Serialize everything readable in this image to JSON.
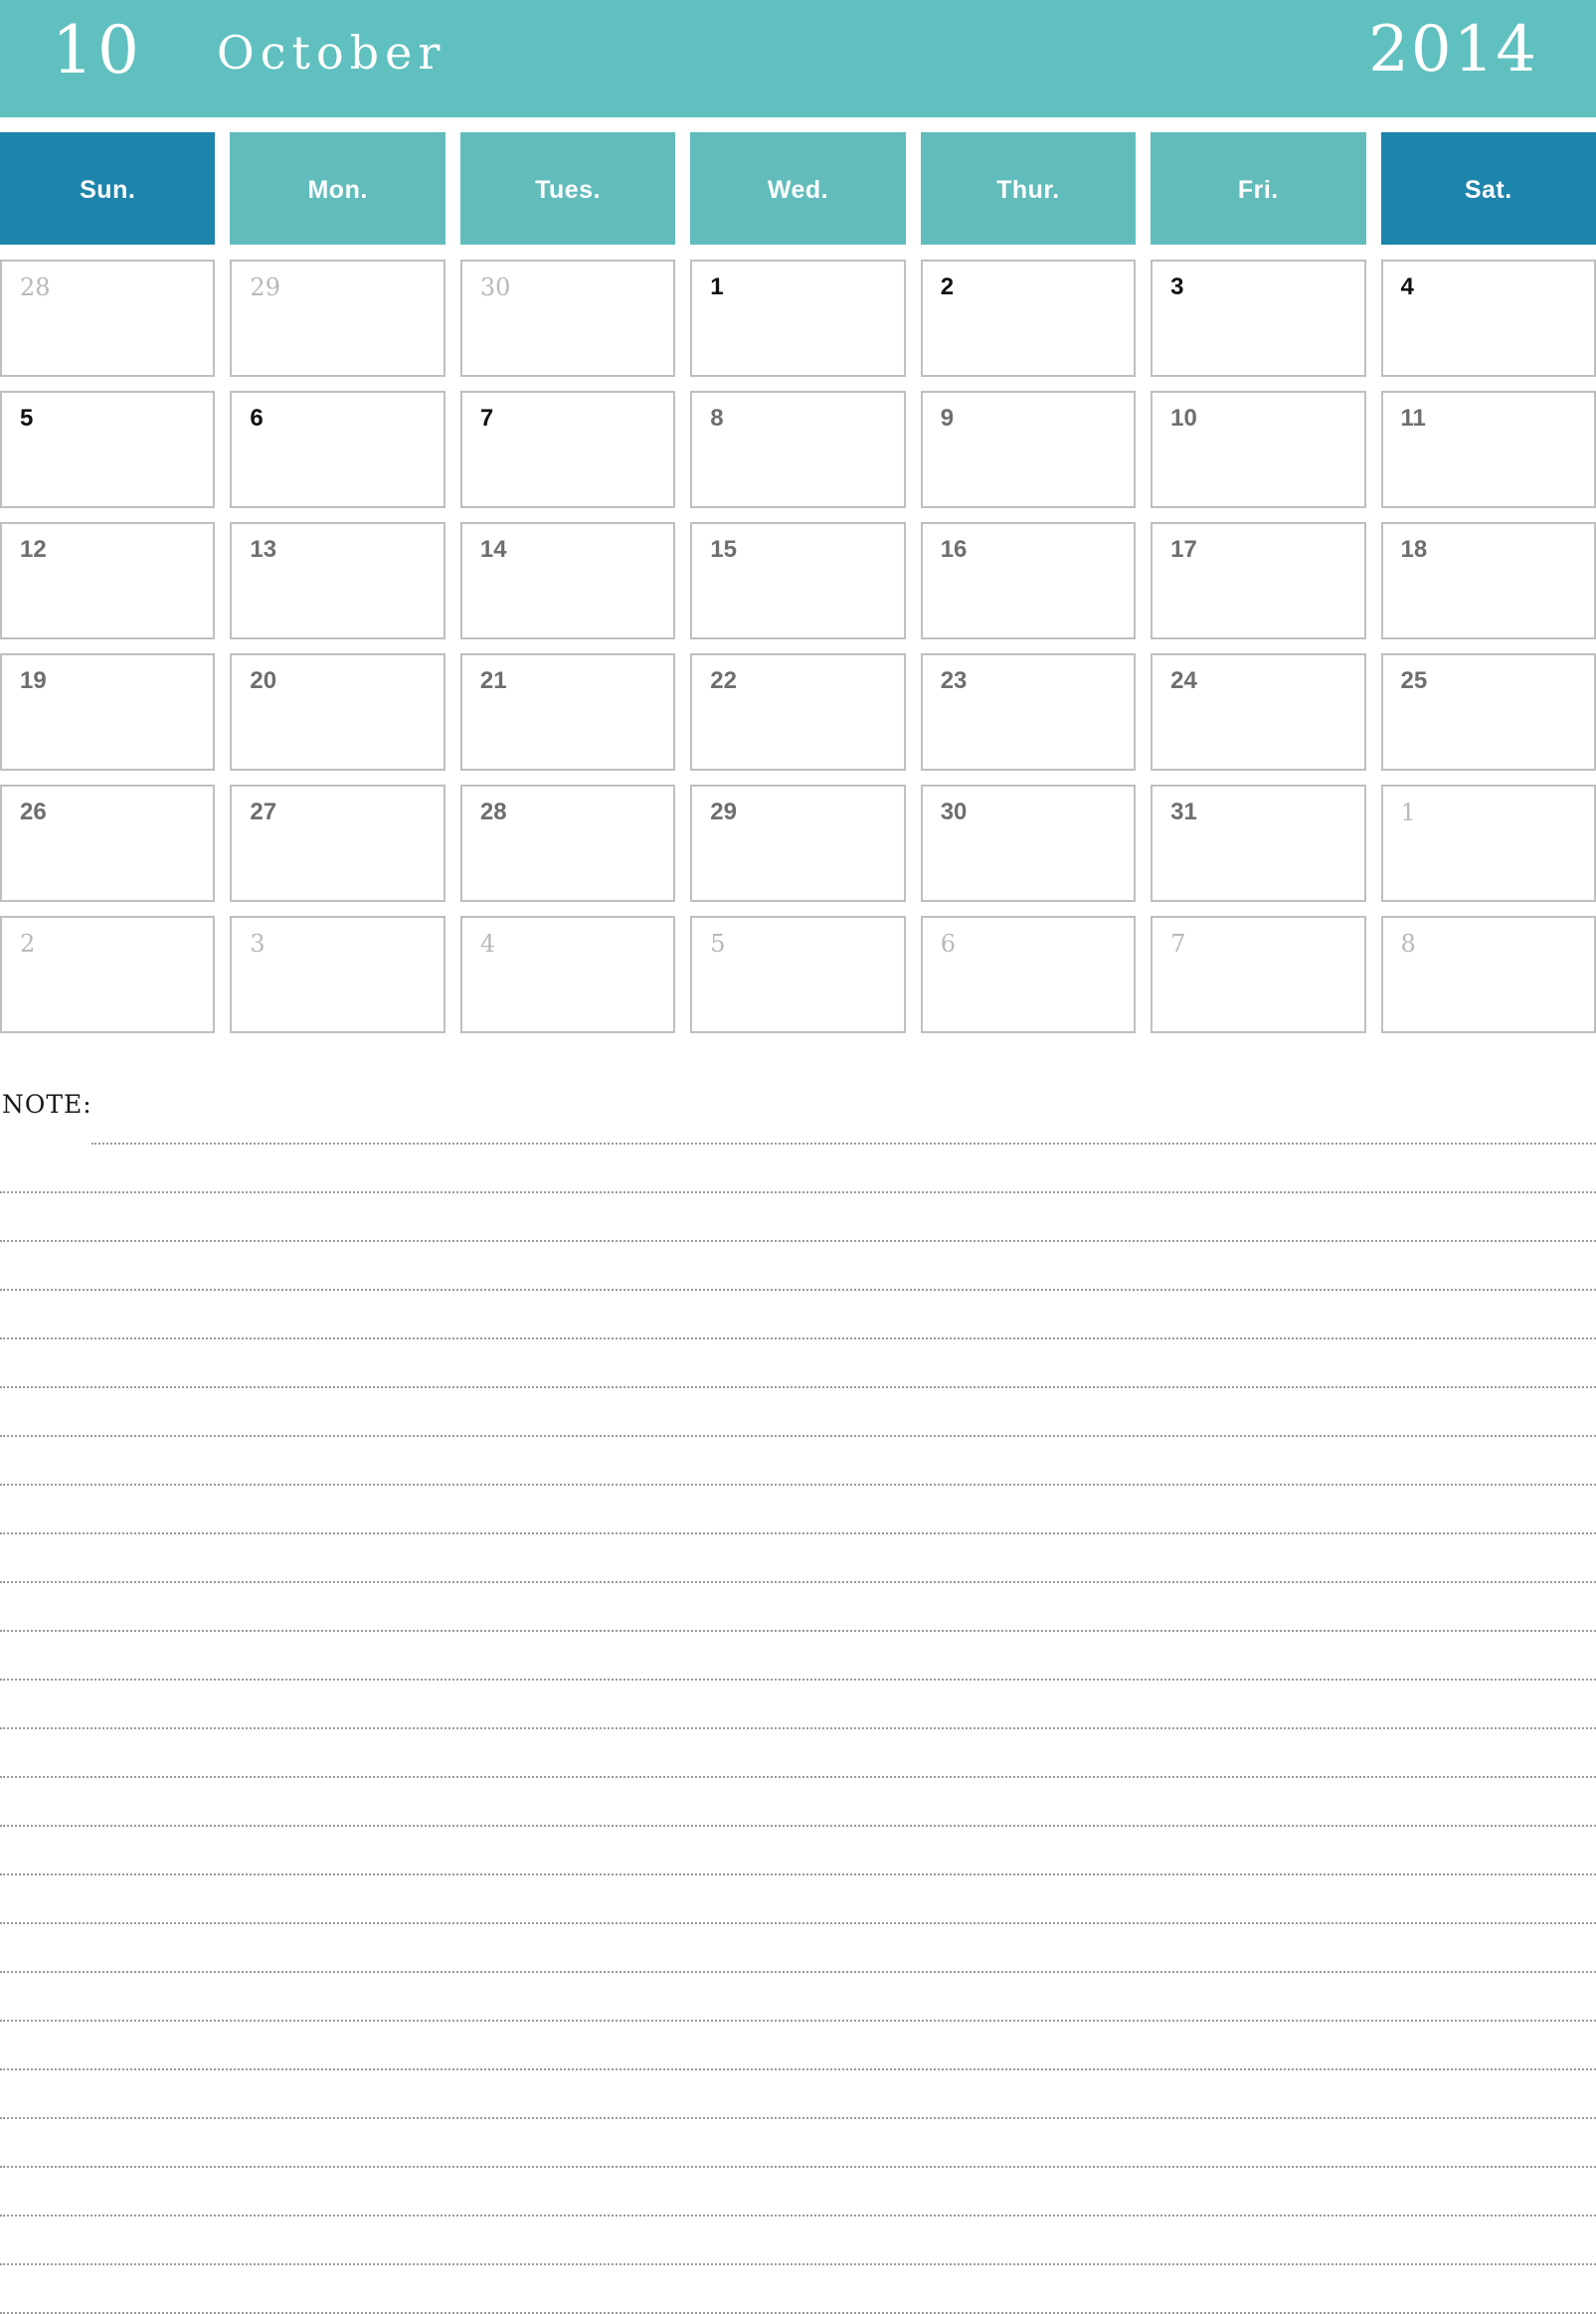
{
  "header": {
    "month_number": "10",
    "month_name": "October",
    "year": "2014",
    "banner_color": "#5fc0bf"
  },
  "weekdays": {
    "colors": {
      "weekday": "#62bcbc",
      "weekend": "#1d84ab",
      "text": "#ffffff"
    },
    "items": [
      {
        "label": "Sun.",
        "weekend": true
      },
      {
        "label": "Mon.",
        "weekend": false
      },
      {
        "label": "Tues.",
        "weekend": false
      },
      {
        "label": "Wed.",
        "weekend": false
      },
      {
        "label": "Thur.",
        "weekend": false
      },
      {
        "label": "Fri.",
        "weekend": false
      },
      {
        "label": "Sat.",
        "weekend": true
      }
    ]
  },
  "grid": {
    "colors": {
      "cell_border": "#bfbfbf",
      "date_strong": "#111111",
      "date_current": "#6e6e6e",
      "date_other": "#b9b9b9"
    },
    "rows": [
      [
        {
          "day": "28",
          "style": "other"
        },
        {
          "day": "29",
          "style": "other"
        },
        {
          "day": "30",
          "style": "other"
        },
        {
          "day": "1",
          "style": "cur-strong"
        },
        {
          "day": "2",
          "style": "cur-strong"
        },
        {
          "day": "3",
          "style": "cur-strong"
        },
        {
          "day": "4",
          "style": "cur-strong"
        }
      ],
      [
        {
          "day": "5",
          "style": "cur-strong"
        },
        {
          "day": "6",
          "style": "cur-strong"
        },
        {
          "day": "7",
          "style": "cur-strong"
        },
        {
          "day": "8",
          "style": "cur"
        },
        {
          "day": "9",
          "style": "cur"
        },
        {
          "day": "10",
          "style": "cur"
        },
        {
          "day": "11",
          "style": "cur"
        }
      ],
      [
        {
          "day": "12",
          "style": "cur"
        },
        {
          "day": "13",
          "style": "cur"
        },
        {
          "day": "14",
          "style": "cur"
        },
        {
          "day": "15",
          "style": "cur"
        },
        {
          "day": "16",
          "style": "cur"
        },
        {
          "day": "17",
          "style": "cur"
        },
        {
          "day": "18",
          "style": "cur"
        }
      ],
      [
        {
          "day": "19",
          "style": "cur"
        },
        {
          "day": "20",
          "style": "cur"
        },
        {
          "day": "21",
          "style": "cur"
        },
        {
          "day": "22",
          "style": "cur"
        },
        {
          "day": "23",
          "style": "cur"
        },
        {
          "day": "24",
          "style": "cur"
        },
        {
          "day": "25",
          "style": "cur"
        }
      ],
      [
        {
          "day": "26",
          "style": "cur"
        },
        {
          "day": "27",
          "style": "cur"
        },
        {
          "day": "28",
          "style": "cur"
        },
        {
          "day": "29",
          "style": "cur"
        },
        {
          "day": "30",
          "style": "cur"
        },
        {
          "day": "31",
          "style": "cur"
        },
        {
          "day": "1",
          "style": "other"
        }
      ],
      [
        {
          "day": "2",
          "style": "other"
        },
        {
          "day": "3",
          "style": "other"
        },
        {
          "day": "4",
          "style": "other"
        },
        {
          "day": "5",
          "style": "other"
        },
        {
          "day": "6",
          "style": "other"
        },
        {
          "day": "7",
          "style": "other"
        },
        {
          "day": "8",
          "style": "other"
        }
      ]
    ]
  },
  "notes": {
    "label": "NOTE:",
    "line_count": 25
  }
}
